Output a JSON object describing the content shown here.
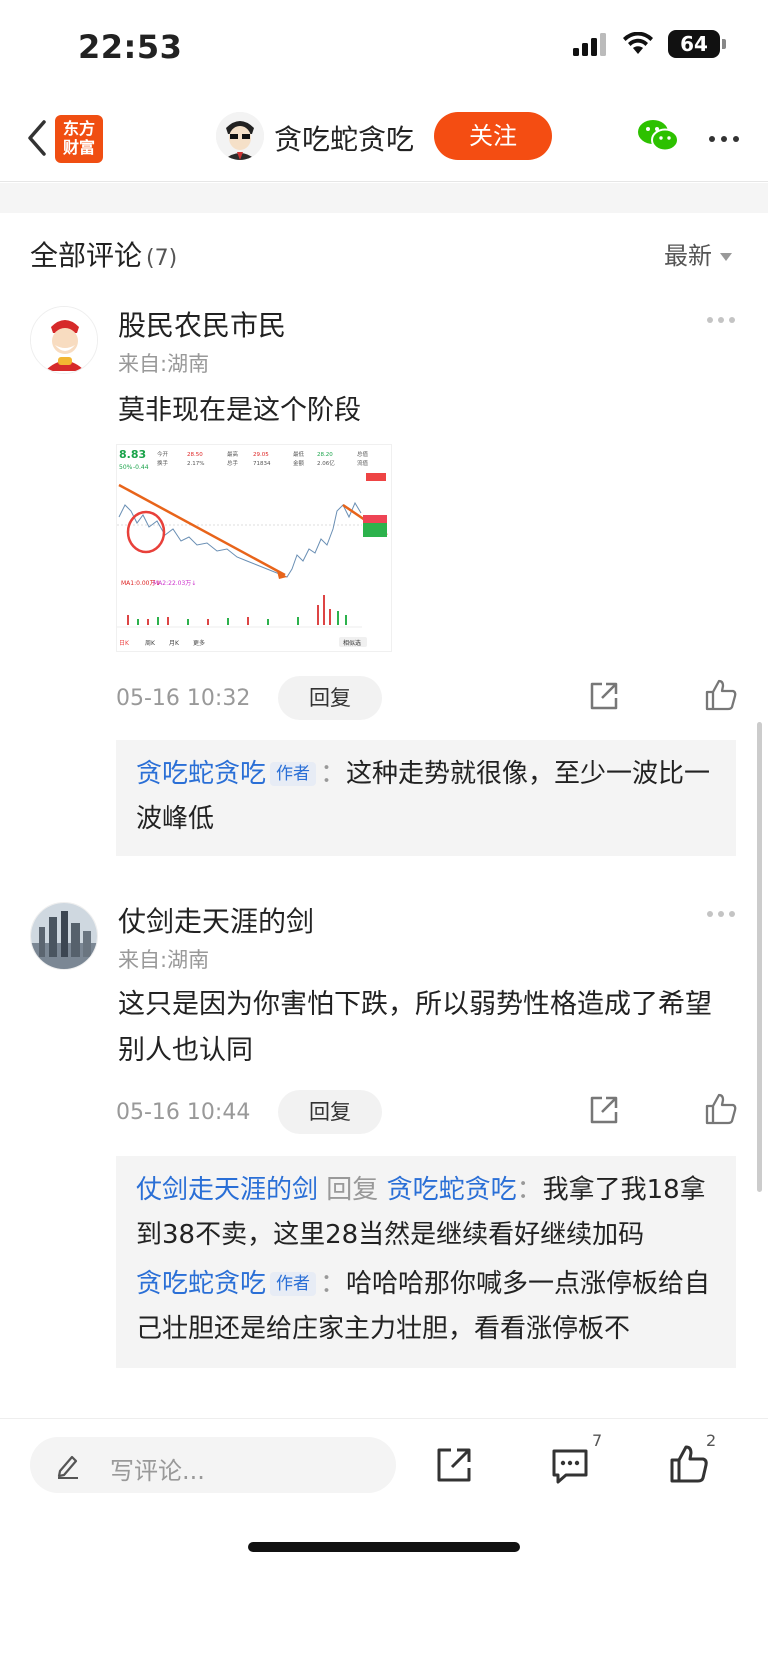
{
  "status": {
    "time": "22:53",
    "battery": "64"
  },
  "nav": {
    "logo_line1": "东方",
    "logo_line2": "财富",
    "author": "贪吃蛇贪吃",
    "follow": "关注"
  },
  "comments_header": {
    "title": "全部评论",
    "count": "(7)",
    "sort": "最新"
  },
  "comments": [
    {
      "user": "股民农民市民",
      "location": "来自:湖南",
      "text": "莫非现在是这个阶段",
      "time": "05-16 10:32",
      "reply_label": "回复",
      "replies": [
        {
          "from": "贪吃蛇贪吃",
          "tag": "作者",
          "sep": "：",
          "text": "这种走势就很像，至少一波比一波峰低"
        }
      ]
    },
    {
      "user": "仗剑走天涯的剑",
      "location": "来自:湖南",
      "text": "这只是因为你害怕下跌，所以弱势性格造成了希望别人也认同",
      "time": "05-16 10:44",
      "reply_label": "回复",
      "replies": [
        {
          "from": "仗剑走天涯的剑",
          "verb": "回复",
          "to": "贪吃蛇贪吃",
          "sep": "：",
          "text": "我拿了我18拿到38不卖，这里28当然是继续看好继续加码"
        },
        {
          "from": "贪吃蛇贪吃",
          "tag": "作者",
          "sep": "：",
          "text": "哈哈哈那你喊多一点涨停板给自己壮胆还是给庄家主力壮胆，看看涨停板不"
        }
      ]
    }
  ],
  "chart_thumb": {
    "price": "8.83",
    "pct": "50%",
    "change": "-0.44",
    "labels": [
      "今开",
      "28.50",
      "最高",
      "29.05",
      "最低",
      "28.20",
      "总值",
      "换手",
      "2.17%",
      "总手",
      "71834",
      "金额",
      "2.06亿",
      "流值"
    ],
    "ma1": "MA1:0.00万↓",
    "ma2": "MA2:22.03万↓",
    "tabs": [
      "日K",
      "周K",
      "月K",
      "更多"
    ],
    "btn": "相似选"
  },
  "bottom": {
    "placeholder": "写评论...",
    "comment_count": "7",
    "like_count": "2"
  }
}
